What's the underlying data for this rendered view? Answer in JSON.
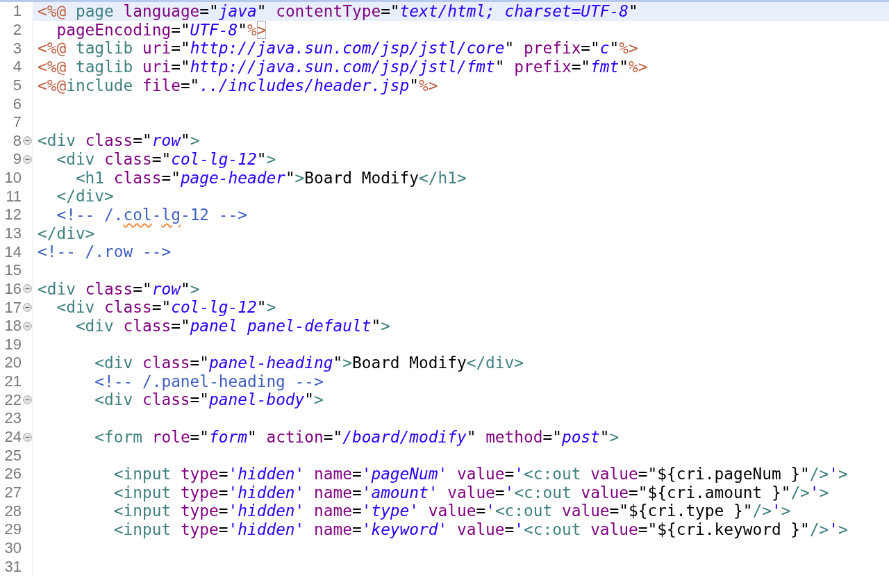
{
  "editor": {
    "lines": [
      {
        "number": "1",
        "current": true,
        "tokens": [
          {
            "kind": "jsp",
            "text": "<%@"
          },
          {
            "kind": "tag",
            "text": " page"
          },
          {
            "kind": "attr",
            "text": " language"
          },
          {
            "kind": "plain",
            "text": "=\""
          },
          {
            "kind": "str",
            "text": "java"
          },
          {
            "kind": "plain",
            "text": "\""
          },
          {
            "kind": "attr",
            "text": " contentType"
          },
          {
            "kind": "plain",
            "text": "=\""
          },
          {
            "kind": "str",
            "text": "text/html; charset=UTF-8"
          },
          {
            "kind": "plain",
            "text": "\""
          }
        ]
      },
      {
        "number": "2",
        "current": false,
        "tokens": [
          {
            "kind": "attr",
            "text": "  pageEncoding"
          },
          {
            "kind": "plain",
            "text": "=\""
          },
          {
            "kind": "str",
            "text": "UTF-8"
          },
          {
            "kind": "plain",
            "text": "\""
          },
          {
            "kind": "jsp",
            "text": "%"
          },
          {
            "kind": "jsp",
            "text": ">",
            "matched": true
          }
        ]
      },
      {
        "number": "3",
        "current": false,
        "tokens": [
          {
            "kind": "jsp",
            "text": "<%@"
          },
          {
            "kind": "tag",
            "text": " taglib"
          },
          {
            "kind": "attr",
            "text": " uri"
          },
          {
            "kind": "plain",
            "text": "=\""
          },
          {
            "kind": "str",
            "text": "http://java.sun.com/jsp/jstl/core"
          },
          {
            "kind": "plain",
            "text": "\""
          },
          {
            "kind": "attr",
            "text": " prefix"
          },
          {
            "kind": "plain",
            "text": "=\""
          },
          {
            "kind": "str",
            "text": "c"
          },
          {
            "kind": "plain",
            "text": "\""
          },
          {
            "kind": "jsp",
            "text": "%>"
          }
        ]
      },
      {
        "number": "4",
        "current": false,
        "tokens": [
          {
            "kind": "jsp",
            "text": "<%@"
          },
          {
            "kind": "tag",
            "text": " taglib"
          },
          {
            "kind": "attr",
            "text": " uri"
          },
          {
            "kind": "plain",
            "text": "=\""
          },
          {
            "kind": "str",
            "text": "http://java.sun.com/jsp/jstl/fmt"
          },
          {
            "kind": "plain",
            "text": "\""
          },
          {
            "kind": "attr",
            "text": " prefix"
          },
          {
            "kind": "plain",
            "text": "=\""
          },
          {
            "kind": "str",
            "text": "fmt"
          },
          {
            "kind": "plain",
            "text": "\""
          },
          {
            "kind": "jsp",
            "text": "%>"
          }
        ]
      },
      {
        "number": "5",
        "current": false,
        "tokens": [
          {
            "kind": "jsp",
            "text": "<%@"
          },
          {
            "kind": "tag",
            "text": "include"
          },
          {
            "kind": "attr",
            "text": " file"
          },
          {
            "kind": "plain",
            "text": "=\""
          },
          {
            "kind": "str",
            "text": "../includes/header.jsp"
          },
          {
            "kind": "plain",
            "text": "\""
          },
          {
            "kind": "jsp",
            "text": "%>"
          }
        ]
      },
      {
        "number": "6",
        "current": false
      },
      {
        "number": "7",
        "current": false
      },
      {
        "number": "8",
        "current": false,
        "foldable": true,
        "tokens": [
          {
            "kind": "tag",
            "text": "<div"
          },
          {
            "kind": "attr",
            "text": " class"
          },
          {
            "kind": "plain",
            "text": "=\""
          },
          {
            "kind": "str",
            "text": "row"
          },
          {
            "kind": "plain",
            "text": "\""
          },
          {
            "kind": "tag",
            "text": ">"
          }
        ]
      },
      {
        "number": "9",
        "current": false,
        "foldable": true,
        "tokens": [
          {
            "kind": "tag",
            "text": "  <div"
          },
          {
            "kind": "attr",
            "text": " class"
          },
          {
            "kind": "plain",
            "text": "=\""
          },
          {
            "kind": "str",
            "text": "col-lg-12"
          },
          {
            "kind": "plain",
            "text": "\""
          },
          {
            "kind": "tag",
            "text": ">"
          }
        ]
      },
      {
        "number": "10",
        "current": false,
        "tokens": [
          {
            "kind": "tag",
            "text": "    <h1"
          },
          {
            "kind": "attr",
            "text": " class"
          },
          {
            "kind": "plain",
            "text": "=\""
          },
          {
            "kind": "str",
            "text": "page-header"
          },
          {
            "kind": "plain",
            "text": "\""
          },
          {
            "kind": "tag",
            "text": ">"
          },
          {
            "kind": "plain",
            "text": "Board Modify"
          },
          {
            "kind": "tag",
            "text": "</h1>"
          }
        ]
      },
      {
        "number": "11",
        "current": false,
        "tokens": [
          {
            "kind": "tag",
            "text": "  </div>"
          }
        ]
      },
      {
        "number": "12",
        "current": false,
        "tokens": [
          {
            "kind": "comment",
            "text": "  <!-- /."
          },
          {
            "kind": "comment",
            "text": "col",
            "misspelled": true
          },
          {
            "kind": "comment",
            "text": "-"
          },
          {
            "kind": "comment",
            "text": "lg",
            "misspelled": true
          },
          {
            "kind": "comment",
            "text": "-12 -->"
          }
        ]
      },
      {
        "number": "13",
        "current": false,
        "tokens": [
          {
            "kind": "tag",
            "text": "</div>"
          }
        ]
      },
      {
        "number": "14",
        "current": false,
        "tokens": [
          {
            "kind": "comment",
            "text": "<!-- /.row -->"
          }
        ]
      },
      {
        "number": "15",
        "current": false
      },
      {
        "number": "16",
        "current": false,
        "foldable": true,
        "tokens": [
          {
            "kind": "tag",
            "text": "<div"
          },
          {
            "kind": "attr",
            "text": " class"
          },
          {
            "kind": "plain",
            "text": "=\""
          },
          {
            "kind": "str",
            "text": "row"
          },
          {
            "kind": "plain",
            "text": "\""
          },
          {
            "kind": "tag",
            "text": ">"
          }
        ]
      },
      {
        "number": "17",
        "current": false,
        "foldable": true,
        "tokens": [
          {
            "kind": "tag",
            "text": "  <div"
          },
          {
            "kind": "attr",
            "text": " class"
          },
          {
            "kind": "plain",
            "text": "=\""
          },
          {
            "kind": "str",
            "text": "col-lg-12"
          },
          {
            "kind": "plain",
            "text": "\""
          },
          {
            "kind": "tag",
            "text": ">"
          }
        ]
      },
      {
        "number": "18",
        "current": false,
        "foldable": true,
        "tokens": [
          {
            "kind": "tag",
            "text": "    <div"
          },
          {
            "kind": "attr",
            "text": " class"
          },
          {
            "kind": "plain",
            "text": "=\""
          },
          {
            "kind": "str",
            "text": "panel panel-default"
          },
          {
            "kind": "plain",
            "text": "\""
          },
          {
            "kind": "tag",
            "text": ">"
          }
        ]
      },
      {
        "number": "19",
        "current": false
      },
      {
        "number": "20",
        "current": false,
        "tokens": [
          {
            "kind": "tag",
            "text": "      <div"
          },
          {
            "kind": "attr",
            "text": " class"
          },
          {
            "kind": "plain",
            "text": "=\""
          },
          {
            "kind": "str",
            "text": "panel-heading"
          },
          {
            "kind": "plain",
            "text": "\""
          },
          {
            "kind": "tag",
            "text": ">"
          },
          {
            "kind": "plain",
            "text": "Board Modify"
          },
          {
            "kind": "tag",
            "text": "</div>"
          }
        ]
      },
      {
        "number": "21",
        "current": false,
        "tokens": [
          {
            "kind": "comment",
            "text": "      <!-- /.panel-heading -->"
          }
        ]
      },
      {
        "number": "22",
        "current": false,
        "foldable": true,
        "tokens": [
          {
            "kind": "tag",
            "text": "      <div"
          },
          {
            "kind": "attr",
            "text": " class"
          },
          {
            "kind": "plain",
            "text": "=\""
          },
          {
            "kind": "str",
            "text": "panel-body"
          },
          {
            "kind": "plain",
            "text": "\""
          },
          {
            "kind": "tag",
            "text": ">"
          }
        ]
      },
      {
        "number": "23",
        "current": false
      },
      {
        "number": "24",
        "current": false,
        "foldable": true,
        "tokens": [
          {
            "kind": "tag",
            "text": "      <form"
          },
          {
            "kind": "attr",
            "text": " role"
          },
          {
            "kind": "plain",
            "text": "=\""
          },
          {
            "kind": "str",
            "text": "form"
          },
          {
            "kind": "plain",
            "text": "\""
          },
          {
            "kind": "attr",
            "text": " action"
          },
          {
            "kind": "plain",
            "text": "=\""
          },
          {
            "kind": "str",
            "text": "/board/modify"
          },
          {
            "kind": "plain",
            "text": "\""
          },
          {
            "kind": "attr",
            "text": " method"
          },
          {
            "kind": "plain",
            "text": "=\""
          },
          {
            "kind": "str",
            "text": "post"
          },
          {
            "kind": "plain",
            "text": "\""
          },
          {
            "kind": "tag",
            "text": ">"
          }
        ]
      },
      {
        "number": "25",
        "current": false
      },
      {
        "number": "26",
        "current": false,
        "tokens": [
          {
            "kind": "tag",
            "text": "        <input"
          },
          {
            "kind": "attr",
            "text": " type"
          },
          {
            "kind": "plain",
            "text": "="
          },
          {
            "kind": "str",
            "text": "'hidden'"
          },
          {
            "kind": "attr",
            "text": " name"
          },
          {
            "kind": "plain",
            "text": "="
          },
          {
            "kind": "str",
            "text": "'pageNum'"
          },
          {
            "kind": "attr",
            "text": " value"
          },
          {
            "kind": "plain",
            "text": "="
          },
          {
            "kind": "str",
            "text": "'"
          },
          {
            "kind": "tag",
            "text": "<c:out"
          },
          {
            "kind": "attr",
            "text": " value"
          },
          {
            "kind": "plain",
            "text": "=\"${cri.pageNum }\""
          },
          {
            "kind": "tag",
            "text": "/>"
          },
          {
            "kind": "str",
            "text": "'"
          },
          {
            "kind": "tag",
            "text": ">"
          }
        ]
      },
      {
        "number": "27",
        "current": false,
        "tokens": [
          {
            "kind": "tag",
            "text": "        <input"
          },
          {
            "kind": "attr",
            "text": " type"
          },
          {
            "kind": "plain",
            "text": "="
          },
          {
            "kind": "str",
            "text": "'hidden'"
          },
          {
            "kind": "attr",
            "text": " name"
          },
          {
            "kind": "plain",
            "text": "="
          },
          {
            "kind": "str",
            "text": "'amount'"
          },
          {
            "kind": "attr",
            "text": " value"
          },
          {
            "kind": "plain",
            "text": "="
          },
          {
            "kind": "str",
            "text": "'"
          },
          {
            "kind": "tag",
            "text": "<c:out"
          },
          {
            "kind": "attr",
            "text": " value"
          },
          {
            "kind": "plain",
            "text": "=\"${cri.amount }\""
          },
          {
            "kind": "tag",
            "text": "/>"
          },
          {
            "kind": "str",
            "text": "'"
          },
          {
            "kind": "tag",
            "text": ">"
          }
        ]
      },
      {
        "number": "28",
        "current": false,
        "tokens": [
          {
            "kind": "tag",
            "text": "        <input"
          },
          {
            "kind": "attr",
            "text": " type"
          },
          {
            "kind": "plain",
            "text": "="
          },
          {
            "kind": "str",
            "text": "'hidden'"
          },
          {
            "kind": "attr",
            "text": " name"
          },
          {
            "kind": "plain",
            "text": "="
          },
          {
            "kind": "str",
            "text": "'type'"
          },
          {
            "kind": "attr",
            "text": " value"
          },
          {
            "kind": "plain",
            "text": "="
          },
          {
            "kind": "str",
            "text": "'"
          },
          {
            "kind": "tag",
            "text": "<c:out"
          },
          {
            "kind": "attr",
            "text": " value"
          },
          {
            "kind": "plain",
            "text": "=\"${cri.type }\""
          },
          {
            "kind": "tag",
            "text": "/>"
          },
          {
            "kind": "str",
            "text": "'"
          },
          {
            "kind": "tag",
            "text": ">"
          }
        ]
      },
      {
        "number": "29",
        "current": false,
        "tokens": [
          {
            "kind": "tag",
            "text": "        <input"
          },
          {
            "kind": "attr",
            "text": " type"
          },
          {
            "kind": "plain",
            "text": "="
          },
          {
            "kind": "str",
            "text": "'hidden'"
          },
          {
            "kind": "attr",
            "text": " name"
          },
          {
            "kind": "plain",
            "text": "="
          },
          {
            "kind": "str",
            "text": "'keyword'"
          },
          {
            "kind": "attr",
            "text": " value"
          },
          {
            "kind": "plain",
            "text": "="
          },
          {
            "kind": "str",
            "text": "'"
          },
          {
            "kind": "tag",
            "text": "<c:out"
          },
          {
            "kind": "attr",
            "text": " value"
          },
          {
            "kind": "plain",
            "text": "=\"${cri.keyword }\""
          },
          {
            "kind": "tag",
            "text": "/>"
          },
          {
            "kind": "str",
            "text": "'"
          },
          {
            "kind": "tag",
            "text": ">"
          }
        ]
      },
      {
        "number": "30",
        "current": false
      },
      {
        "number": "31",
        "current": false
      }
    ]
  }
}
